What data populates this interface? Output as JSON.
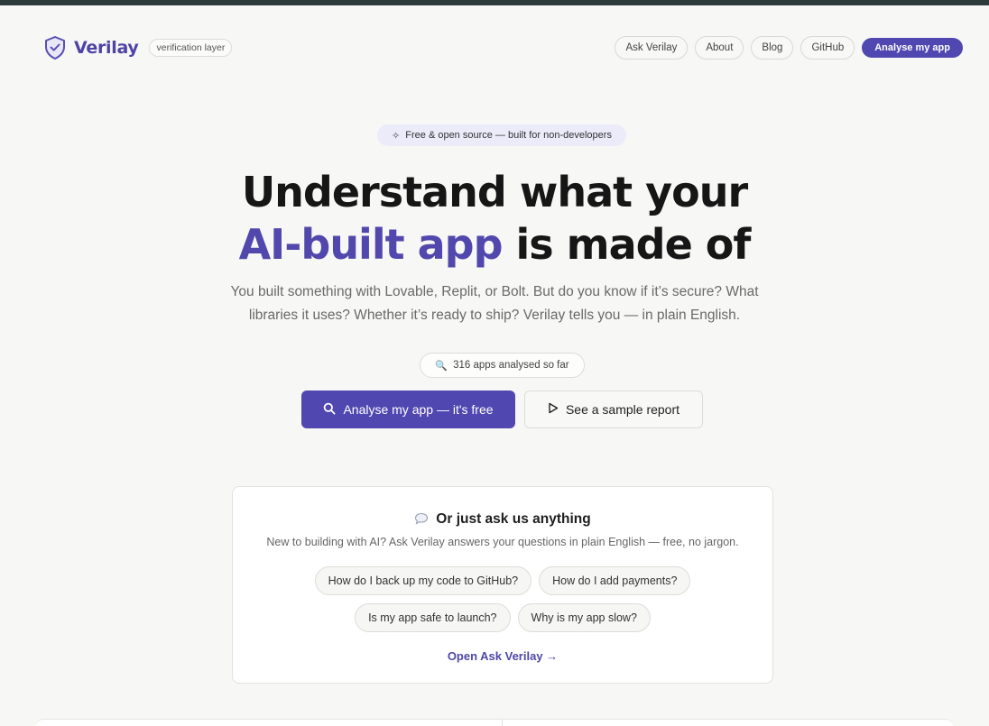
{
  "header": {
    "brand_name": "Verilay",
    "brand_tag": "verification layer",
    "nav": [
      {
        "label": "Ask Verilay"
      },
      {
        "label": "About"
      },
      {
        "label": "Blog"
      },
      {
        "label": "GitHub"
      }
    ],
    "primary_cta": "Analyse my app"
  },
  "hero": {
    "badge": "Free & open source — built for non-developers",
    "title_line1": "Understand what your",
    "title_accent": "AI-built app",
    "title_rest": " is made of",
    "subtitle": "You built something with Lovable, Replit, or Bolt. But do you know if it’s secure? What libraries it uses? Whether it’s ready to ship? Verilay tells you — in plain English.",
    "counter": "316 apps analysed so far",
    "cta_primary": "Analyse my app — it's free",
    "cta_secondary": "See a sample report"
  },
  "ask": {
    "title": "Or just ask us anything",
    "subtitle": "New to building with AI? Ask Verilay answers your questions in plain English — free, no jargon.",
    "chips_row1": [
      "How do I back up my code to GitHub?",
      "How do I add payments?"
    ],
    "chips_row2": [
      "Is my app safe to launch?",
      "Why is my app slow?"
    ],
    "link": "Open Ask Verilay →"
  },
  "colors": {
    "accent": "#5047b0",
    "topbar": "#2c3a3a",
    "background": "#f7f7f5"
  },
  "icons": {
    "brand": "shield-check-icon",
    "badge": "sparkle-icon",
    "counter": "magnifier-icon",
    "cta_primary": "search-icon",
    "cta_secondary": "play-icon",
    "ask": "speech-bubble-icon"
  }
}
